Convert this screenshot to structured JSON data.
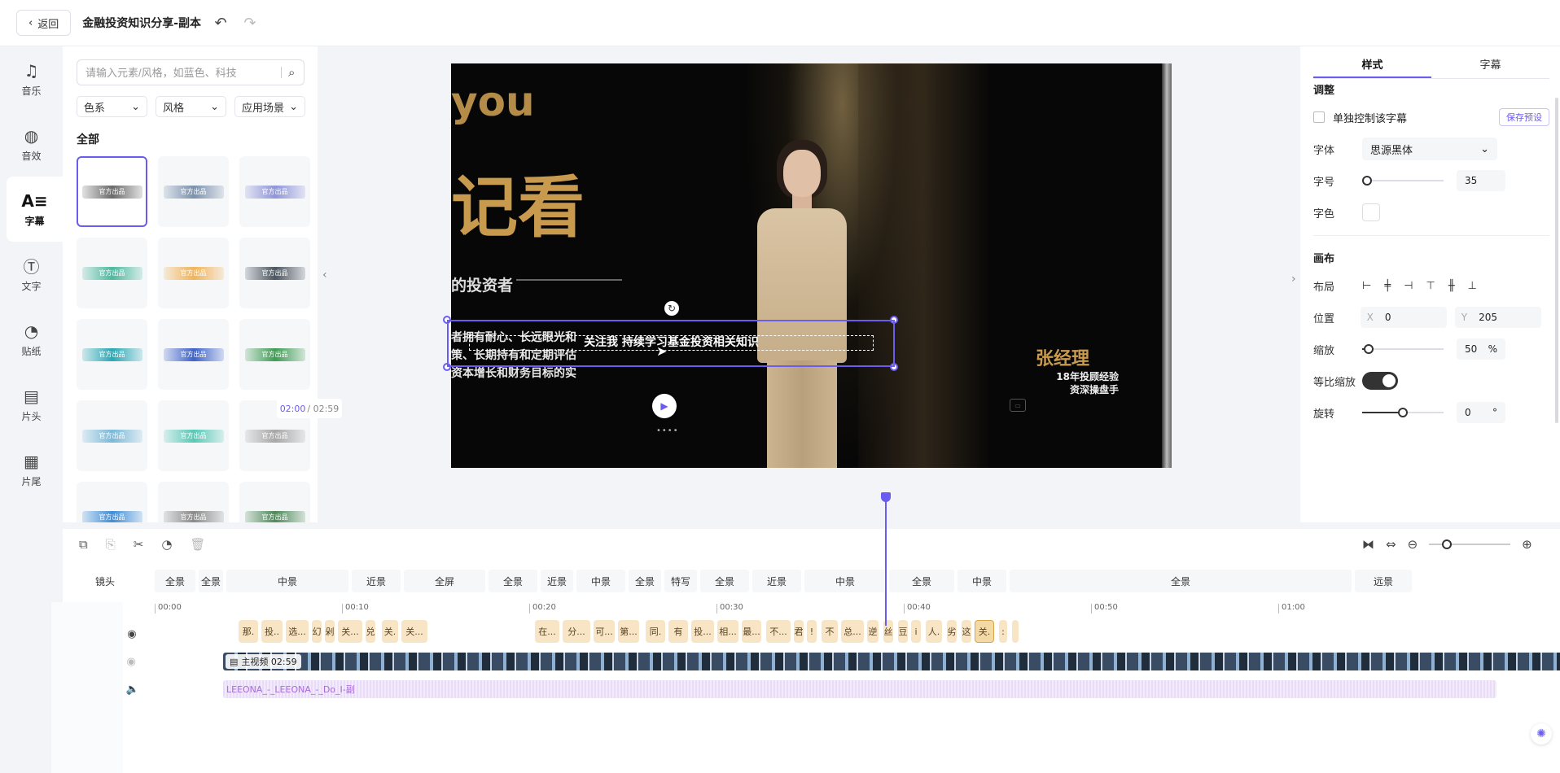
{
  "header": {
    "back_label": "返回",
    "project_title": "金融投资知识分享-副本"
  },
  "nav": [
    {
      "label": "音乐",
      "icon": "music-icon"
    },
    {
      "label": "音效",
      "icon": "sound-effect-icon"
    },
    {
      "label": "字幕",
      "icon": "subtitle-icon",
      "active": true
    },
    {
      "label": "文字",
      "icon": "text-icon"
    },
    {
      "label": "贴纸",
      "icon": "sticker-icon"
    },
    {
      "label": "片头",
      "icon": "intro-icon"
    },
    {
      "label": "片尾",
      "icon": "outro-icon"
    }
  ],
  "panel": {
    "search_placeholder": "请输入元素/风格，如蓝色、科技",
    "filters": [
      "色系",
      "风格",
      "应用场景"
    ],
    "section": "全部",
    "template_label": "官方出品",
    "template_colors": [
      "#6b6b6b",
      "#7b92ad",
      "#8f96d9",
      "#4fb9a0",
      "#f1b45a",
      "#4d5761",
      "#2aa8b5",
      "#3e63c9",
      "#3f9c55",
      "#7ab9d9",
      "#58c9b6",
      "#a7a7a7",
      "#3f8ed9",
      "#8b8b8b",
      "#4f8a5a"
    ]
  },
  "video": {
    "you": "you",
    "big": "记看",
    "investor": "的投资者",
    "desc": [
      "者拥有耐心、长远眼光和",
      "策、长期持有和定期评估",
      "资本增长和财务目标的实"
    ],
    "manager_name": "张经理",
    "manager_sub": [
      "18年投顾经验",
      "资深操盘手"
    ],
    "subtitle": "关注我 持续学习基金投资相关知识"
  },
  "player": {
    "current": "02:00",
    "total": "/ 02:59"
  },
  "right_panel": {
    "tabs": [
      "样式",
      "字幕"
    ],
    "adjust_label": "调整",
    "solo_label": "单独控制该字幕",
    "save_preset": "保存预设",
    "font_label": "字体",
    "font_value": "思源黑体",
    "size_label": "字号",
    "size_value": "35",
    "size_fraction": 0.06,
    "color_label": "字色",
    "canvas_label": "画布",
    "layout_label": "布局",
    "position_label": "位置",
    "pos_x_key": "X",
    "pos_x": "0",
    "pos_y_key": "Y",
    "pos_y": "205",
    "scale_label": "缩放",
    "scale_value": "50",
    "scale_unit": "%",
    "scale_fraction": 0.08,
    "ratio_label": "等比缩放",
    "rotate_label": "旋转",
    "rotate_value": "0",
    "rotate_unit": "°",
    "rotate_fraction": 0.5
  },
  "timeline": {
    "shots_label": "镜头",
    "shots": [
      {
        "label": "全景",
        "w": 50
      },
      {
        "label": "全景",
        "w": 30
      },
      {
        "label": "中景",
        "w": 150
      },
      {
        "label": "近景",
        "w": 60
      },
      {
        "label": "全屏",
        "w": 100
      },
      {
        "label": "全景",
        "w": 60
      },
      {
        "label": "近景",
        "w": 40
      },
      {
        "label": "中景",
        "w": 60
      },
      {
        "label": "全景",
        "w": 40
      },
      {
        "label": "特写",
        "w": 40
      },
      {
        "label": "全景",
        "w": 60
      },
      {
        "label": "近景",
        "w": 60
      },
      {
        "label": "中景",
        "w": 100
      },
      {
        "label": "全景",
        "w": 80
      },
      {
        "label": "中景",
        "w": 60
      },
      {
        "label": "全景",
        "w": 420
      },
      {
        "label": "远景",
        "w": 70
      }
    ],
    "ruler": [
      "00:00",
      "00:10",
      "00:20",
      "00:30",
      "00:40",
      "00:50",
      "01:00"
    ],
    "text_segments": [
      {
        "l": 0,
        "w": 24,
        "t": "那."
      },
      {
        "l": 28,
        "w": 26,
        "t": "投.."
      },
      {
        "l": 58,
        "w": 28,
        "t": "选..."
      },
      {
        "l": 90,
        "w": 12,
        "t": "幻"
      },
      {
        "l": 106,
        "w": 12,
        "t": "剁"
      },
      {
        "l": 122,
        "w": 30,
        "t": "关..."
      },
      {
        "l": 156,
        "w": 12,
        "t": "兑"
      },
      {
        "l": 176,
        "w": 20,
        "t": "关."
      },
      {
        "l": 200,
        "w": 32,
        "t": "关..."
      },
      {
        "l": 364,
        "w": 30,
        "t": "在..."
      },
      {
        "l": 398,
        "w": 34,
        "t": "分..."
      },
      {
        "l": 436,
        "w": 26,
        "t": "可..."
      },
      {
        "l": 466,
        "w": 26,
        "t": "第..."
      },
      {
        "l": 500,
        "w": 24,
        "t": "同."
      },
      {
        "l": 528,
        "w": 24,
        "t": "有"
      },
      {
        "l": 556,
        "w": 28,
        "t": "投..."
      },
      {
        "l": 588,
        "w": 26,
        "t": "相..."
      },
      {
        "l": 618,
        "w": 24,
        "t": "最..."
      },
      {
        "l": 648,
        "w": 30,
        "t": "不..."
      },
      {
        "l": 682,
        "w": 12,
        "t": "君"
      },
      {
        "l": 698,
        "w": 12,
        "t": "!"
      },
      {
        "l": 716,
        "w": 20,
        "t": "不"
      },
      {
        "l": 740,
        "w": 28,
        "t": "总..."
      },
      {
        "l": 772,
        "w": 14,
        "t": "逆"
      },
      {
        "l": 792,
        "w": 12,
        "t": "丝"
      },
      {
        "l": 810,
        "w": 12,
        "t": "豆"
      },
      {
        "l": 826,
        "w": 12,
        "t": "i"
      },
      {
        "l": 844,
        "w": 20,
        "t": "人."
      },
      {
        "l": 870,
        "w": 12,
        "t": "劣"
      },
      {
        "l": 888,
        "w": 12,
        "t": "这"
      },
      {
        "l": 904,
        "w": 24,
        "t": "关.",
        "active": true
      },
      {
        "l": 934,
        "w": 10,
        "t": ":"
      },
      {
        "l": 950,
        "w": 8,
        "t": ""
      }
    ],
    "video_badge": "主视频 02:59",
    "audio_label": "LEEONA_-_LEEONA_-_Do_I-副"
  }
}
